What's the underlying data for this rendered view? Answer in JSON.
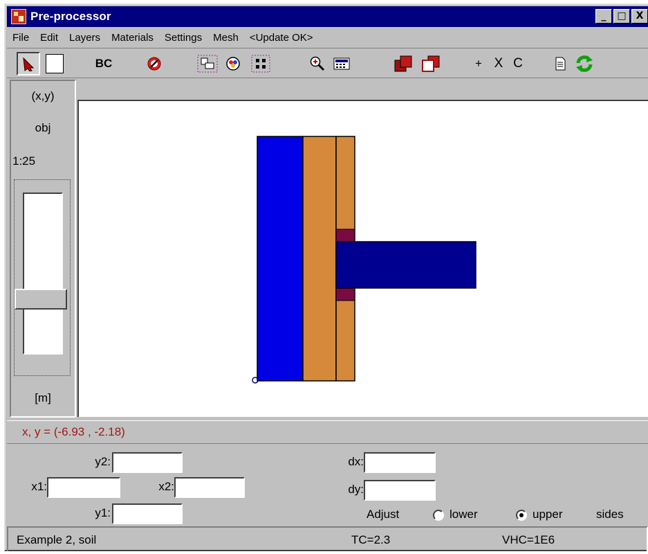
{
  "window": {
    "title": "Pre-processor",
    "controls": {
      "minimize": "_",
      "maximize": "□",
      "close": "X"
    }
  },
  "menu": {
    "items": [
      "File",
      "Edit",
      "Layers",
      "Materials",
      "Settings",
      "Mesh",
      "<Update OK>"
    ]
  },
  "toolbar": {
    "bc_label": "BC",
    "plus": "+",
    "cross": "X",
    "c_label": "C",
    "icons": [
      "select-arrow-icon",
      "rectangle-icon",
      "no-entry-icon",
      "layers-icon",
      "palette-icon",
      "grid-dots-icon",
      "zoom-in-icon",
      "calculator-icon",
      "filled-square-icon",
      "outline-square-icon",
      "document-icon",
      "refresh-icon"
    ]
  },
  "left_panel": {
    "coords_label": "(x,y)",
    "obj_label": "obj",
    "scale": "1:25",
    "unit": "[m]",
    "slider_level": 0.68
  },
  "canvas": {
    "colors": {
      "blue_layer": "#0000e6",
      "orange_layer": "#d58a3b",
      "beam": "#000090",
      "seal": "#7a0b42",
      "outline": "#000000"
    }
  },
  "coords": {
    "text": "x, y = (-6.93 , -2.18)"
  },
  "form": {
    "y2_label": "y2:",
    "x1_label": "x1:",
    "x2_label": "x2:",
    "y1_label": "y1:",
    "dx_label": "dx:",
    "dy_label": "dy:",
    "adjust_label": "Adjust",
    "lower_label": "lower",
    "upper_label": "upper",
    "sides_label": "sides",
    "y2_value": "",
    "x1_value": "",
    "x2_value": "",
    "y1_value": "",
    "dx_value": "",
    "dy_value": "",
    "selected_side": "upper"
  },
  "status": {
    "name": "Example 2, soil",
    "tc": "TC=2.3",
    "vhc": "VHC=1E6"
  }
}
